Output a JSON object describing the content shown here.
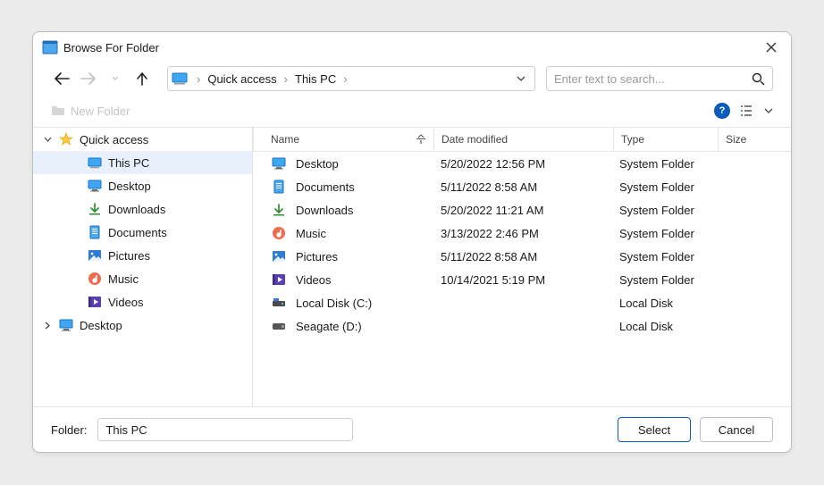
{
  "title": "Browse For Folder",
  "breadcrumbs": [
    "Quick access",
    "This PC"
  ],
  "search_placeholder": "Enter text to search...",
  "new_folder_label": "New Folder",
  "columns": {
    "name": "Name",
    "date": "Date modified",
    "type": "Type",
    "size": "Size"
  },
  "tree": [
    {
      "indent": 0,
      "toggle": "down",
      "icon": "star",
      "label": "Quick access",
      "selected": false
    },
    {
      "indent": 1,
      "toggle": "",
      "icon": "pc",
      "label": "This PC",
      "selected": true
    },
    {
      "indent": 1,
      "toggle": "",
      "icon": "desktop",
      "label": "Desktop",
      "selected": false
    },
    {
      "indent": 1,
      "toggle": "",
      "icon": "download",
      "label": "Downloads",
      "selected": false
    },
    {
      "indent": 1,
      "toggle": "",
      "icon": "document",
      "label": "Documents",
      "selected": false
    },
    {
      "indent": 1,
      "toggle": "",
      "icon": "picture",
      "label": "Pictures",
      "selected": false
    },
    {
      "indent": 1,
      "toggle": "",
      "icon": "music",
      "label": "Music",
      "selected": false
    },
    {
      "indent": 1,
      "toggle": "",
      "icon": "video",
      "label": "Videos",
      "selected": false
    },
    {
      "indent": 0,
      "toggle": "right",
      "icon": "desktop",
      "label": "Desktop",
      "selected": false
    }
  ],
  "rows": [
    {
      "icon": "desktop",
      "name": "Desktop",
      "date": "5/20/2022 12:56 PM",
      "type": "System Folder",
      "size": ""
    },
    {
      "icon": "document",
      "name": "Documents",
      "date": "5/11/2022 8:58 AM",
      "type": "System Folder",
      "size": ""
    },
    {
      "icon": "download",
      "name": "Downloads",
      "date": "5/20/2022 11:21 AM",
      "type": "System Folder",
      "size": ""
    },
    {
      "icon": "music",
      "name": "Music",
      "date": "3/13/2022 2:46 PM",
      "type": "System Folder",
      "size": ""
    },
    {
      "icon": "picture",
      "name": "Pictures",
      "date": "5/11/2022 8:58 AM",
      "type": "System Folder",
      "size": ""
    },
    {
      "icon": "video",
      "name": "Videos",
      "date": "10/14/2021 5:19 PM",
      "type": "System Folder",
      "size": ""
    },
    {
      "icon": "localdisk",
      "name": "Local Disk (C:)",
      "date": "",
      "type": "Local Disk",
      "size": ""
    },
    {
      "icon": "extdisk",
      "name": "Seagate (D:)",
      "date": "",
      "type": "Local Disk",
      "size": ""
    }
  ],
  "footer": {
    "label": "Folder:",
    "value": "This PC",
    "select": "Select",
    "cancel": "Cancel"
  }
}
